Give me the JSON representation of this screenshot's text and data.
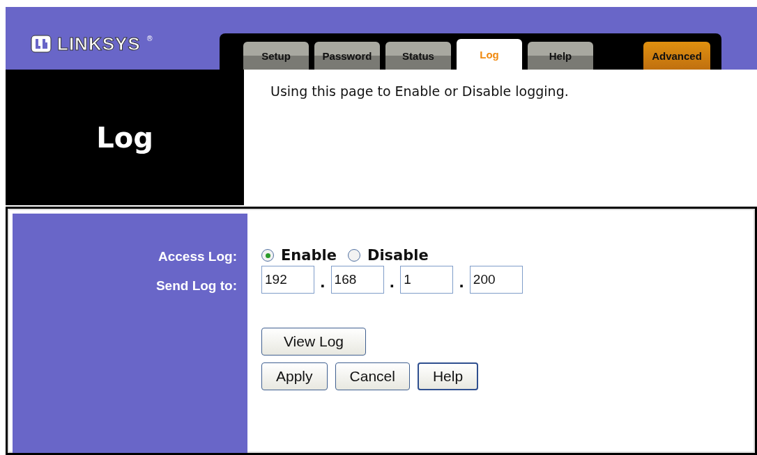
{
  "logo": {
    "name": "LINKSYS",
    "mark": "®"
  },
  "tabs": [
    {
      "label": "Setup",
      "kind": "normal",
      "selected": false
    },
    {
      "label": "Password",
      "kind": "normal",
      "selected": false
    },
    {
      "label": "Status",
      "kind": "normal",
      "selected": false
    },
    {
      "label": "Log",
      "kind": "normal",
      "selected": true
    },
    {
      "label": "Help",
      "kind": "normal",
      "selected": false
    },
    {
      "label": "Advanced",
      "kind": "advanced",
      "selected": false
    }
  ],
  "page_title": "Log",
  "description": "Using this page to Enable or Disable logging.",
  "form": {
    "access_log": {
      "label": "Access Log:",
      "options": [
        {
          "label": "Enable",
          "selected": true
        },
        {
          "label": "Disable",
          "selected": false
        }
      ]
    },
    "send_log_to": {
      "label": "Send Log to:",
      "separator": ".",
      "octets": [
        "192",
        "168",
        "1",
        "200"
      ]
    }
  },
  "view_button": "View Log",
  "buttons": [
    {
      "label": "Apply",
      "focused": false
    },
    {
      "label": "Cancel",
      "focused": false
    },
    {
      "label": "Help",
      "focused": true
    }
  ]
}
